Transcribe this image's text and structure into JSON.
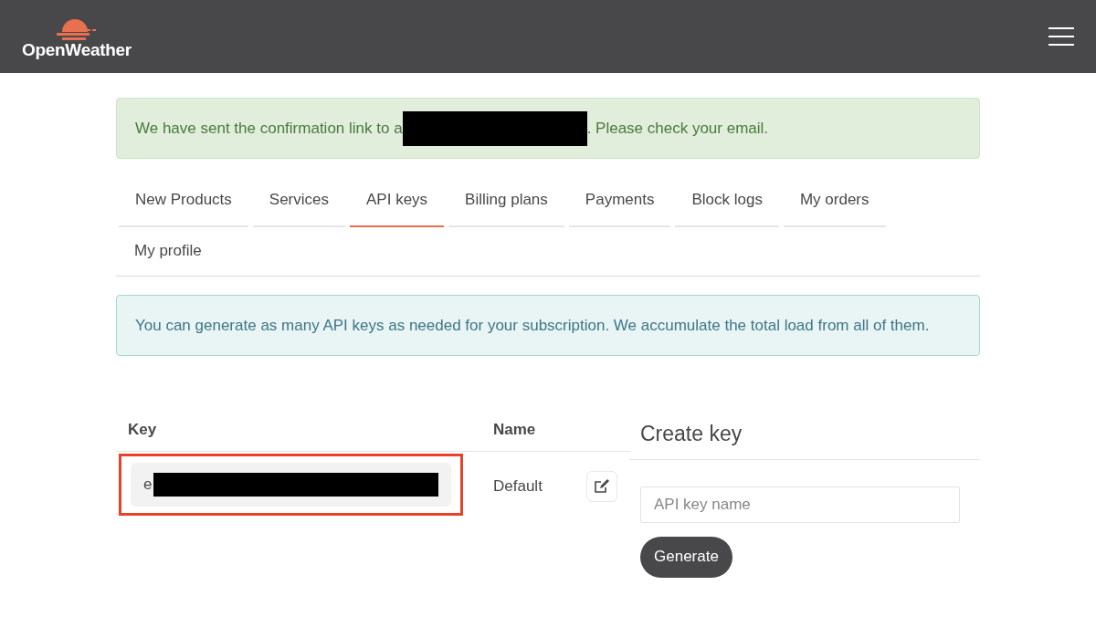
{
  "header": {
    "logo_text": "OpenWeather"
  },
  "alert": {
    "text_before": "We have sent the confirmation link to a",
    "redacted": true,
    "text_after": ". Please check your email."
  },
  "tabs": [
    {
      "label": "New Products",
      "selected": false
    },
    {
      "label": "Services",
      "selected": false
    },
    {
      "label": "API keys",
      "selected": true
    },
    {
      "label": "Billing plans",
      "selected": false
    },
    {
      "label": "Payments",
      "selected": false
    },
    {
      "label": "Block logs",
      "selected": false
    },
    {
      "label": "My orders",
      "selected": false
    },
    {
      "label": "My profile",
      "selected": false
    }
  ],
  "info": {
    "text": "You can generate as many API keys as needed for your subscription. We accumulate the total load from all of them."
  },
  "table": {
    "columns": [
      "Key",
      "Name"
    ],
    "rows": [
      {
        "key": "e",
        "key_redacted": true,
        "highlighted": true,
        "name": "Default"
      }
    ]
  },
  "create_key": {
    "title": "Create key",
    "placeholder": "API key name",
    "button": "Generate"
  }
}
